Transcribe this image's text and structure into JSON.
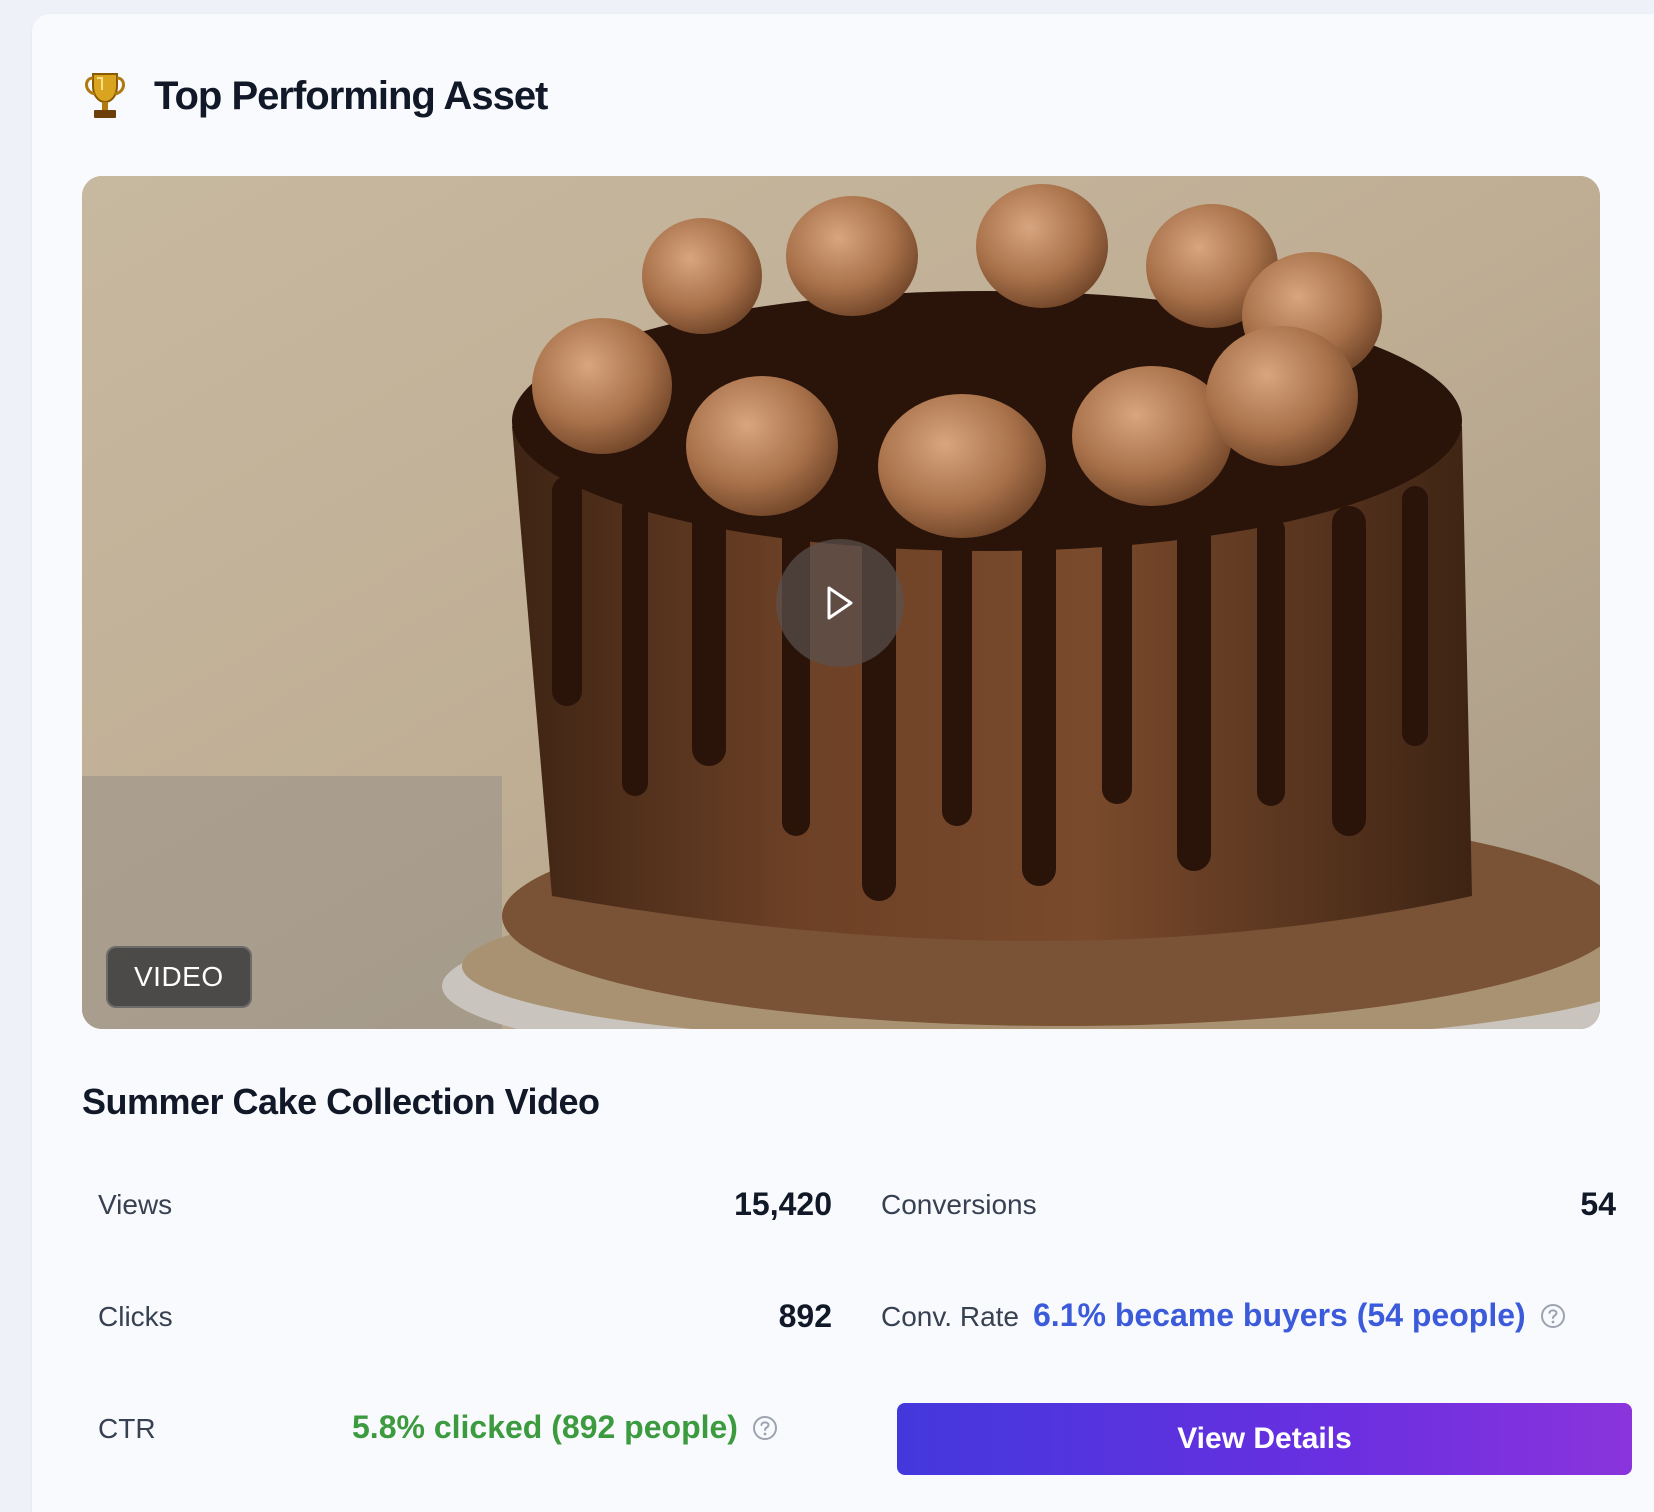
{
  "header": {
    "title": "Top Performing Asset",
    "icon": "trophy-icon"
  },
  "asset": {
    "media_type_badge": "VIDEO",
    "name": "Summer Cake Collection Video",
    "thumbnail": "chocolate-drip-cake-image",
    "play_icon": "play-icon"
  },
  "metrics": {
    "views": {
      "label": "Views",
      "value": "15,420"
    },
    "clicks": {
      "label": "Clicks",
      "value": "892"
    },
    "ctr": {
      "label": "CTR",
      "value": "5.8% clicked (892 people)"
    },
    "conversions": {
      "label": "Conversions",
      "value": "54"
    },
    "conv_rate": {
      "label": "Conv. Rate",
      "value": "6.1% became buyers (54 people)"
    }
  },
  "actions": {
    "view_details_label": "View Details"
  },
  "colors": {
    "ctr_text": "#3c9a3f",
    "conv_rate_text": "#3b5bdb",
    "button_gradient_start": "#4338dc",
    "button_gradient_end": "#8a34dc"
  }
}
